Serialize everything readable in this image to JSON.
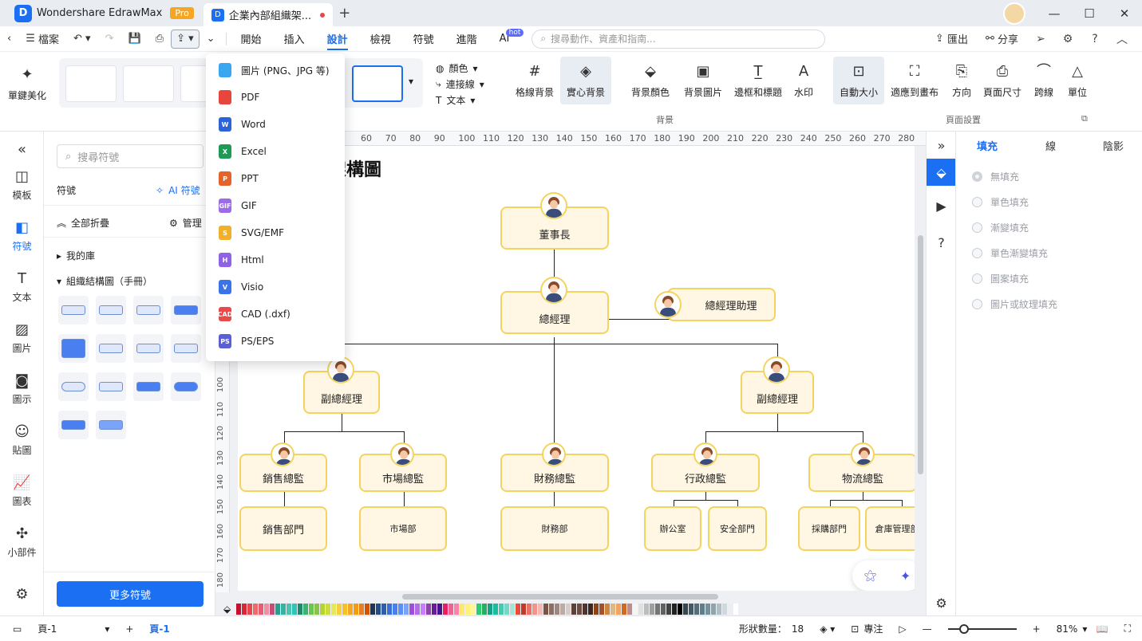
{
  "app": {
    "name": "Wondershare EdrawMax",
    "badge": "Pro",
    "doc_tab": "企業內部組織架...",
    "logo": "D"
  },
  "menubar": {
    "file": "檔案",
    "tabs": [
      "開始",
      "插入",
      "設計",
      "檢視",
      "符號",
      "進階",
      "AI"
    ],
    "active_tab": "設計",
    "hot_badge": "hot",
    "search_placeholder": "搜尋動作、資產和指南...",
    "export": "匯出",
    "share": "分享"
  },
  "ribbon": {
    "one_click": "單鍵美化",
    "color": "顏色",
    "connector": "連接線",
    "text": "文本",
    "grid_bg": "格線背景",
    "solid_bg": "實心背景",
    "bg_color": "背景顏色",
    "bg_image": "背景圖片",
    "border_title": "邊框和標題",
    "watermark": "水印",
    "auto_size": "自動大小",
    "fit_canvas": "適應到畫布",
    "orientation": "方向",
    "page_size": "頁面尺寸",
    "jump_line": "跨線",
    "unit": "單位",
    "group_background": "背景",
    "group_page_setup": "頁面設置"
  },
  "export_menu": [
    "圖片 (PNG、JPG 等)",
    "PDF",
    "Word",
    "Excel",
    "PPT",
    "GIF",
    "SVG/EMF",
    "Html",
    "Visio",
    "CAD (.dxf)",
    "PS/EPS"
  ],
  "export_icons": [
    {
      "label": "",
      "color": "#3aa8f0"
    },
    {
      "label": "",
      "color": "#e8453c"
    },
    {
      "label": "W",
      "color": "#2b63d9"
    },
    {
      "label": "X",
      "color": "#1f9a55"
    },
    {
      "label": "P",
      "color": "#e5622b"
    },
    {
      "label": "GIF",
      "color": "#9b6be8"
    },
    {
      "label": "S",
      "color": "#f0b02c"
    },
    {
      "label": "H",
      "color": "#8e63e6"
    },
    {
      "label": "V",
      "color": "#3b73e8"
    },
    {
      "label": "CAD",
      "color": "#e84a4a"
    },
    {
      "label": "PS",
      "color": "#5b5fd6"
    }
  ],
  "rail": [
    "模板",
    "符號",
    "文本",
    "圖片",
    "圖示",
    "貼圖",
    "圖表",
    "小部件"
  ],
  "rail_active": "符號",
  "symbols": {
    "search_placeholder": "搜尋符號",
    "title": "符號",
    "ai_symbols": "AI 符號",
    "collapse_all": "全部折疊",
    "manage": "管理",
    "my_library": "我的庫",
    "org_chart_manual": "組織結構圖（手冊）",
    "more_symbols": "更多符號"
  },
  "ruler": {
    "h": [
      "60",
      "70",
      "80",
      "90",
      "100",
      "110",
      "120",
      "130",
      "140",
      "150",
      "160",
      "170",
      "180",
      "190",
      "200",
      "210",
      "220",
      "230",
      "240",
      "250",
      "260",
      "270",
      "280"
    ],
    "v": [
      "100",
      "110",
      "120",
      "130",
      "140",
      "150",
      "160",
      "170",
      "180"
    ]
  },
  "diagram": {
    "title": "組織架構圖",
    "nodes": {
      "chairman": "董事長",
      "gm": "總經理",
      "gm_assistant": "總經理助理",
      "vp_left": "副總經理",
      "vp_right": "副總經理",
      "sales_dir": "銷售總監",
      "market_dir": "市場總監",
      "finance_dir": "財務總監",
      "admin_dir": "行政總監",
      "logistics_dir": "物流總監",
      "sales_dept": "銷售部門",
      "market_dept": "市場部",
      "finance_dept": "財務部",
      "office": "辦公室",
      "security_dept": "安全部門",
      "purchase_dept": "採購部門",
      "warehouse_dept": "倉庫管理部"
    }
  },
  "props": {
    "tabs": [
      "填充",
      "線",
      "陰影"
    ],
    "active_tab": "填充",
    "fill_options": [
      "無填充",
      "單色填充",
      "漸變填充",
      "單色漸變填充",
      "圖案填充",
      "圖片或紋理填充"
    ]
  },
  "status": {
    "page_select": "頁-1",
    "page_tab": "頁-1",
    "shape_count_label": "形狀數量：",
    "shape_count": "18",
    "focus": "專注",
    "zoom": "81%"
  },
  "colors": {
    "accent": "#1a6ff2",
    "node_border": "#f3d45e",
    "node_fill": "#fff6e3",
    "palette": [
      "#c8102e",
      "#d62839",
      "#e5484d",
      "#f06a6a",
      "#e85d75",
      "#f08fa0",
      "#c94b7a",
      "#2a9d8f",
      "#34b3a0",
      "#4cc3b1",
      "#2ec4b6",
      "#1f8a70",
      "#3cb371",
      "#6cc551",
      "#8bc34a",
      "#b5d334",
      "#cddc39",
      "#e4e85d",
      "#f4d03f",
      "#f6c026",
      "#f5a623",
      "#f39c12",
      "#e67e22",
      "#d35400",
      "#1d3557",
      "#264e86",
      "#2e5eaa",
      "#3a6fd8",
      "#4a7ff0",
      "#5d8ff5",
      "#7ba3f7",
      "#9d4edd",
      "#b06ee3",
      "#c77dff",
      "#8e44ad",
      "#6a1b9a",
      "#4a148c",
      "#e91e63",
      "#f06292",
      "#ff80ab",
      "#ffe66d",
      "#fff176",
      "#fff59d",
      "#2ecc71",
      "#27ae60",
      "#16a085",
      "#1abc9c",
      "#48c9b0",
      "#76d7c4",
      "#a3e4d7",
      "#e74c3c",
      "#c0392b",
      "#ec7063",
      "#f1948a",
      "#f5b7b1",
      "#795548",
      "#8d6e63",
      "#a1887f",
      "#bcaaa4",
      "#d7ccc8",
      "#5d4037",
      "#6d4c41",
      "#4e342e",
      "#3e2723",
      "#8b4513",
      "#a0522d",
      "#cd853f",
      "#deb887",
      "#f4a460",
      "#d2691e",
      "#bc8f8f",
      "#f5f5f5",
      "#e0e0e0",
      "#bdbdbd",
      "#9e9e9e",
      "#757575",
      "#616161",
      "#424242",
      "#212121",
      "#000000",
      "#37474f",
      "#455a64",
      "#546e7a",
      "#607d8b",
      "#78909c",
      "#90a4ae",
      "#b0bec5",
      "#cfd8dc",
      "#eceff1",
      "#ffffff"
    ]
  }
}
